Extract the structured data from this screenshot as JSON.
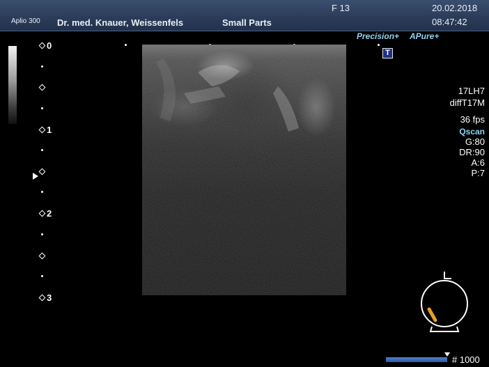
{
  "header": {
    "system_model": "Aplio 300",
    "facility": "Dr. med. Knauer, Weissenfels",
    "preset": "Small Parts",
    "frequency": "F 13",
    "date": "20.02.2018",
    "time": "08:47:42"
  },
  "depth_scale": {
    "labels": [
      "0",
      "1",
      "2",
      "3"
    ]
  },
  "features": {
    "precision": "Precision+",
    "apure": "APure+",
    "t_badge": "T"
  },
  "params": {
    "probe": "17LH7",
    "mode": "diffT17M",
    "frame_rate": "36 fps",
    "qscan": "Qscan",
    "gain": "G:80",
    "dynamic_range": "DR:90",
    "a": "A:6",
    "p": "P:7"
  },
  "cine": {
    "frame_label": "# 1000"
  },
  "colors": {
    "header": "#2c3d5a",
    "accent": "#8fd3f0",
    "probe_marker": "#e8a020",
    "cine_bar": "#3b6bb8"
  }
}
